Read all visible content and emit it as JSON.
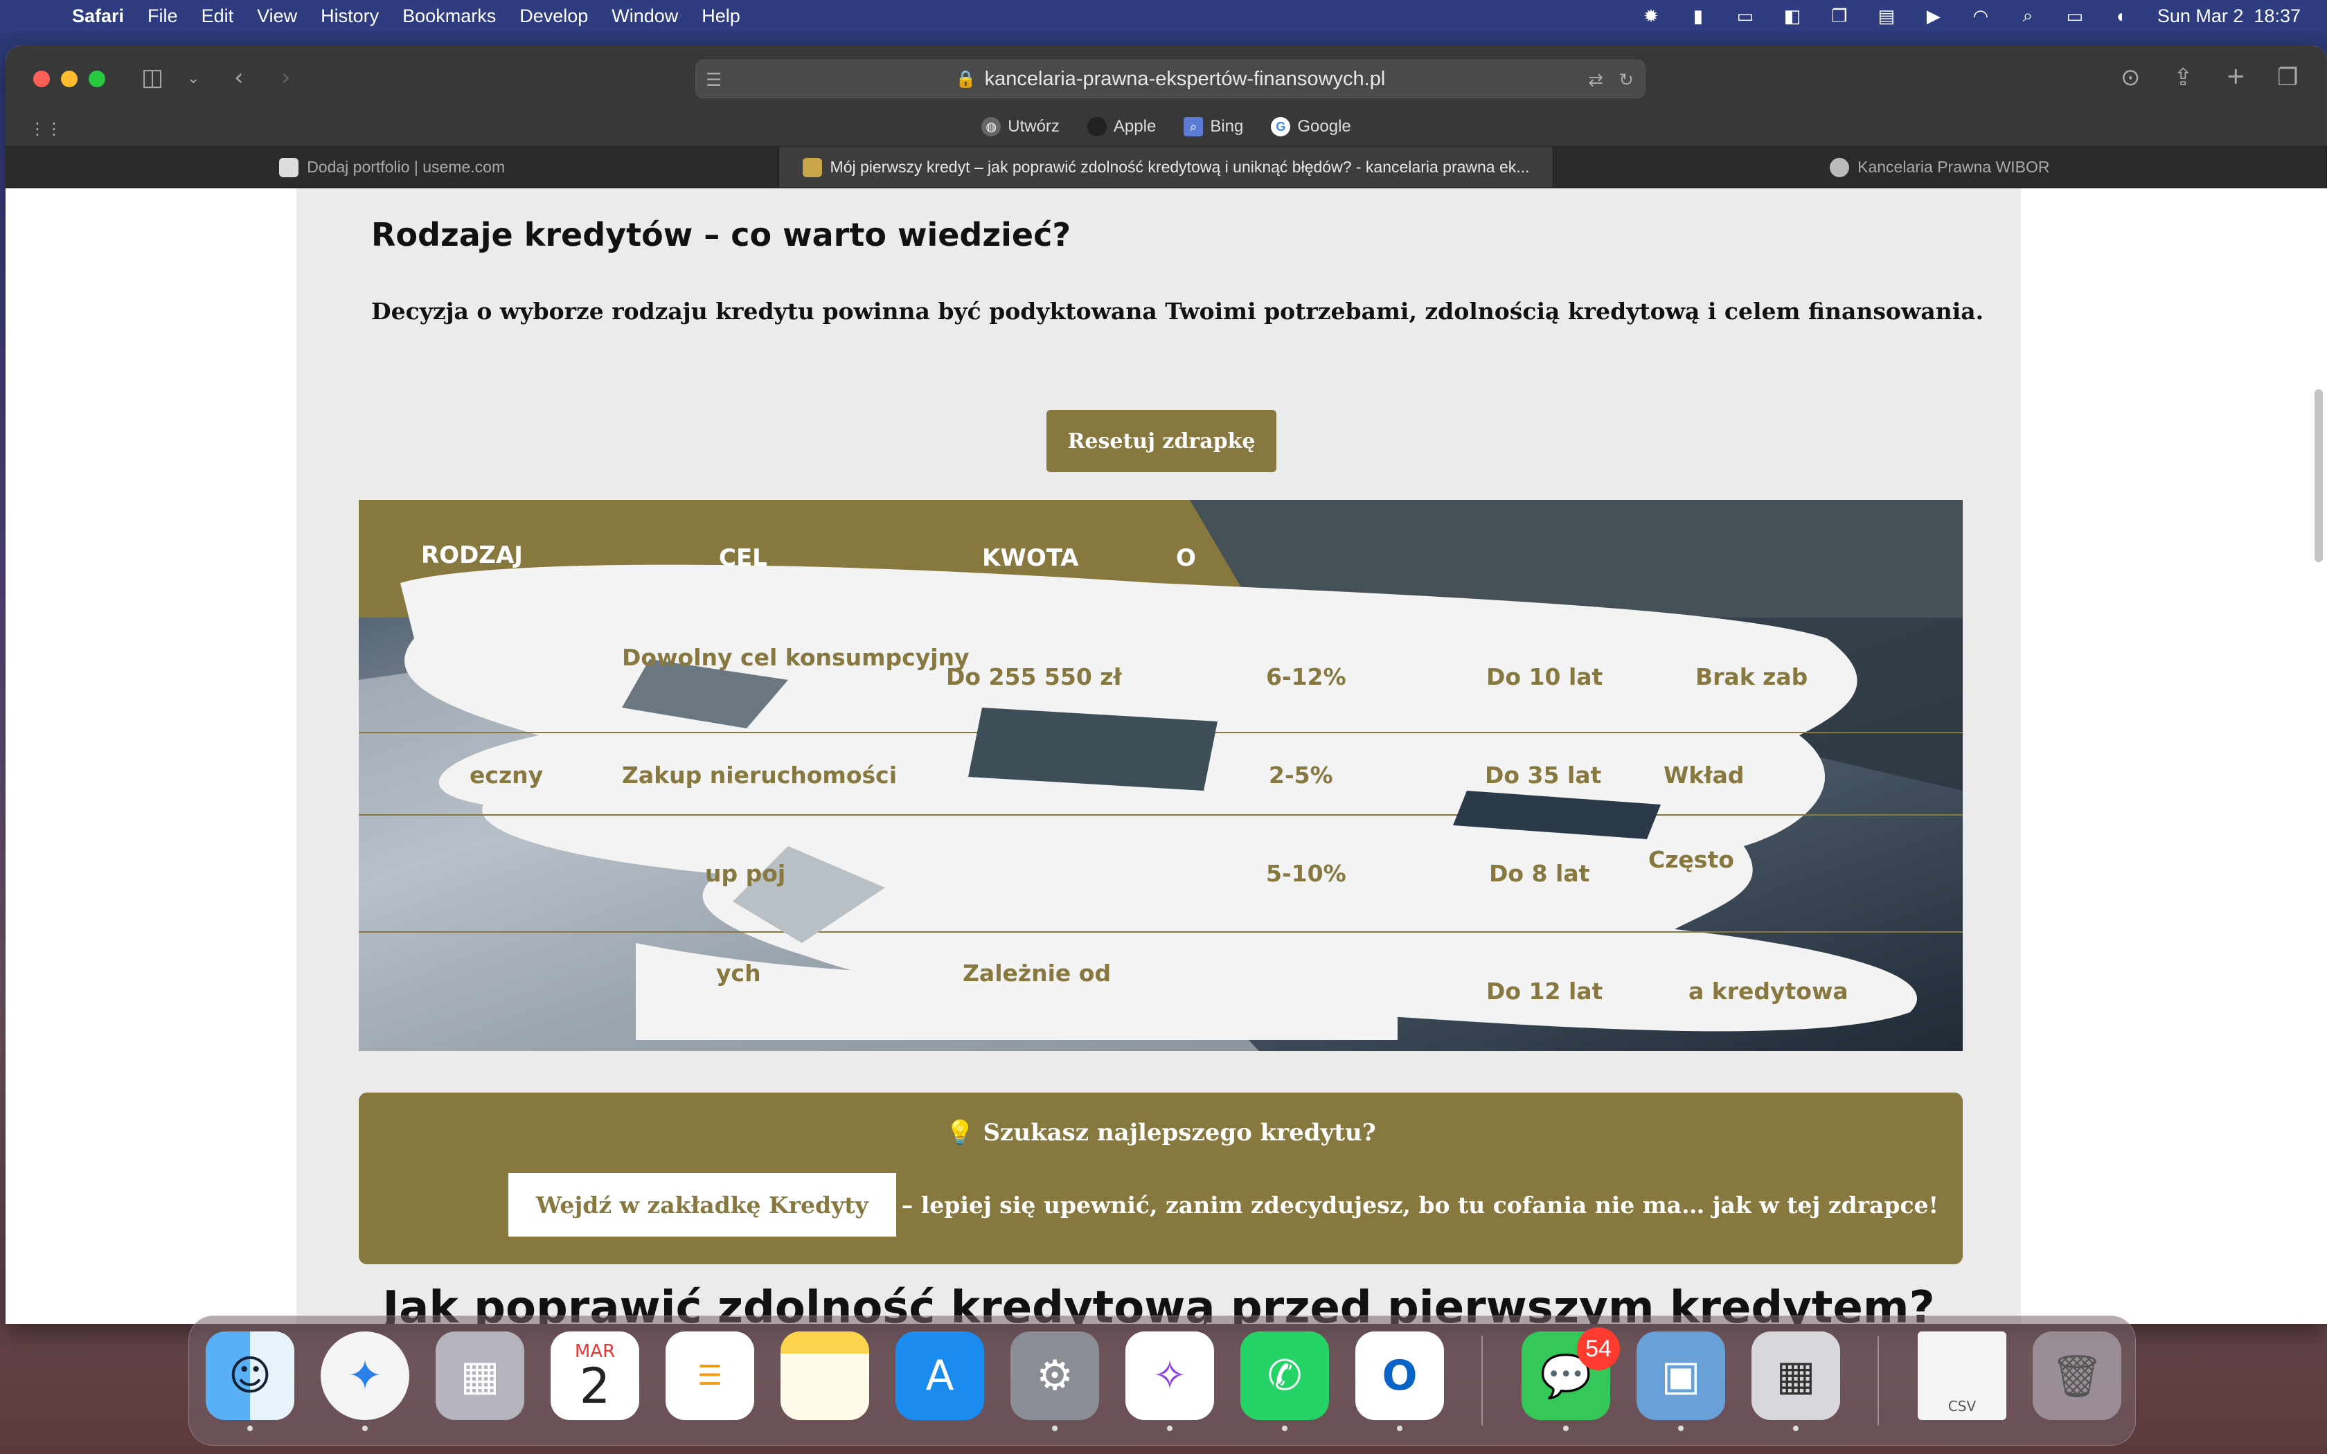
{
  "menubar": {
    "app_name": "Safari",
    "items": [
      "File",
      "Edit",
      "View",
      "History",
      "Bookmarks",
      "Develop",
      "Window",
      "Help"
    ],
    "datetime": "Sun Mar 2  18:37"
  },
  "browser": {
    "url": "kancelaria-prawna-ekspertów-finansowych.pl",
    "bookmarks": [
      "Utwórz",
      "Apple",
      "Bing",
      "Google"
    ],
    "tabs": [
      "Dodaj portfolio | useme.com",
      "Mój pierwszy kredyt – jak poprawić zdolność kredytową i uniknąć błędów? - kancelaria prawna ek...",
      "Kancelaria Prawna WIBOR"
    ]
  },
  "page": {
    "section_title": "Rodzaje kredytów – co warto wiedzieć?",
    "lead": "Decyzja o wyborze rodzaju kredytu powinna być podyktowana Twoimi potrzebami, zdolnością kredytową i celem finansowania.",
    "reset_button": "Resetuj zdrapkę",
    "table_headers": {
      "h1": "RODZAJ",
      "h2": "CEL",
      "h3": "KWOTA",
      "h4": "O"
    },
    "cells": {
      "r1c2": "Dowolny cel konsumpcyjny",
      "r1c3": "Do 255 550 zł",
      "r1c4": "6-12%",
      "r1c5": "Do 10 lat",
      "r1c6": "Brak zab",
      "r2c1": "eczny",
      "r2c2": "Zakup nieruchomości",
      "r2c4": "2-5%",
      "r2c5": "Do 35 lat",
      "r2c6": "Wkład",
      "r3c1": "up poj",
      "r3c4": "5-10%",
      "r3c5": "Do 8 lat",
      "r3c6": "Często",
      "r4c1": "ych",
      "r4c3": "Zależnie od",
      "r4c5": "Do 12 lat",
      "r4c6": "a kredytowa"
    },
    "promo_title": "💡 Szukasz najlepszego kredytu?",
    "promo_cta": "Wejdź w zakładkę Kredyty",
    "promo_text": "– lepiej się upewnić, zanim zdecydujesz, bo tu cofania nie ma… jak w tej zdrapce!",
    "next_heading": "Jak poprawić zdolność kredytową przed pierwszym kredytem?"
  },
  "dock": {
    "calendar_month": "MAR",
    "calendar_day": "2",
    "messages_badge": "54",
    "csv_label": "CSV"
  },
  "colors": {
    "accent": "#86783f",
    "menubar": "#303e80",
    "article_bg": "#ebebeb"
  }
}
